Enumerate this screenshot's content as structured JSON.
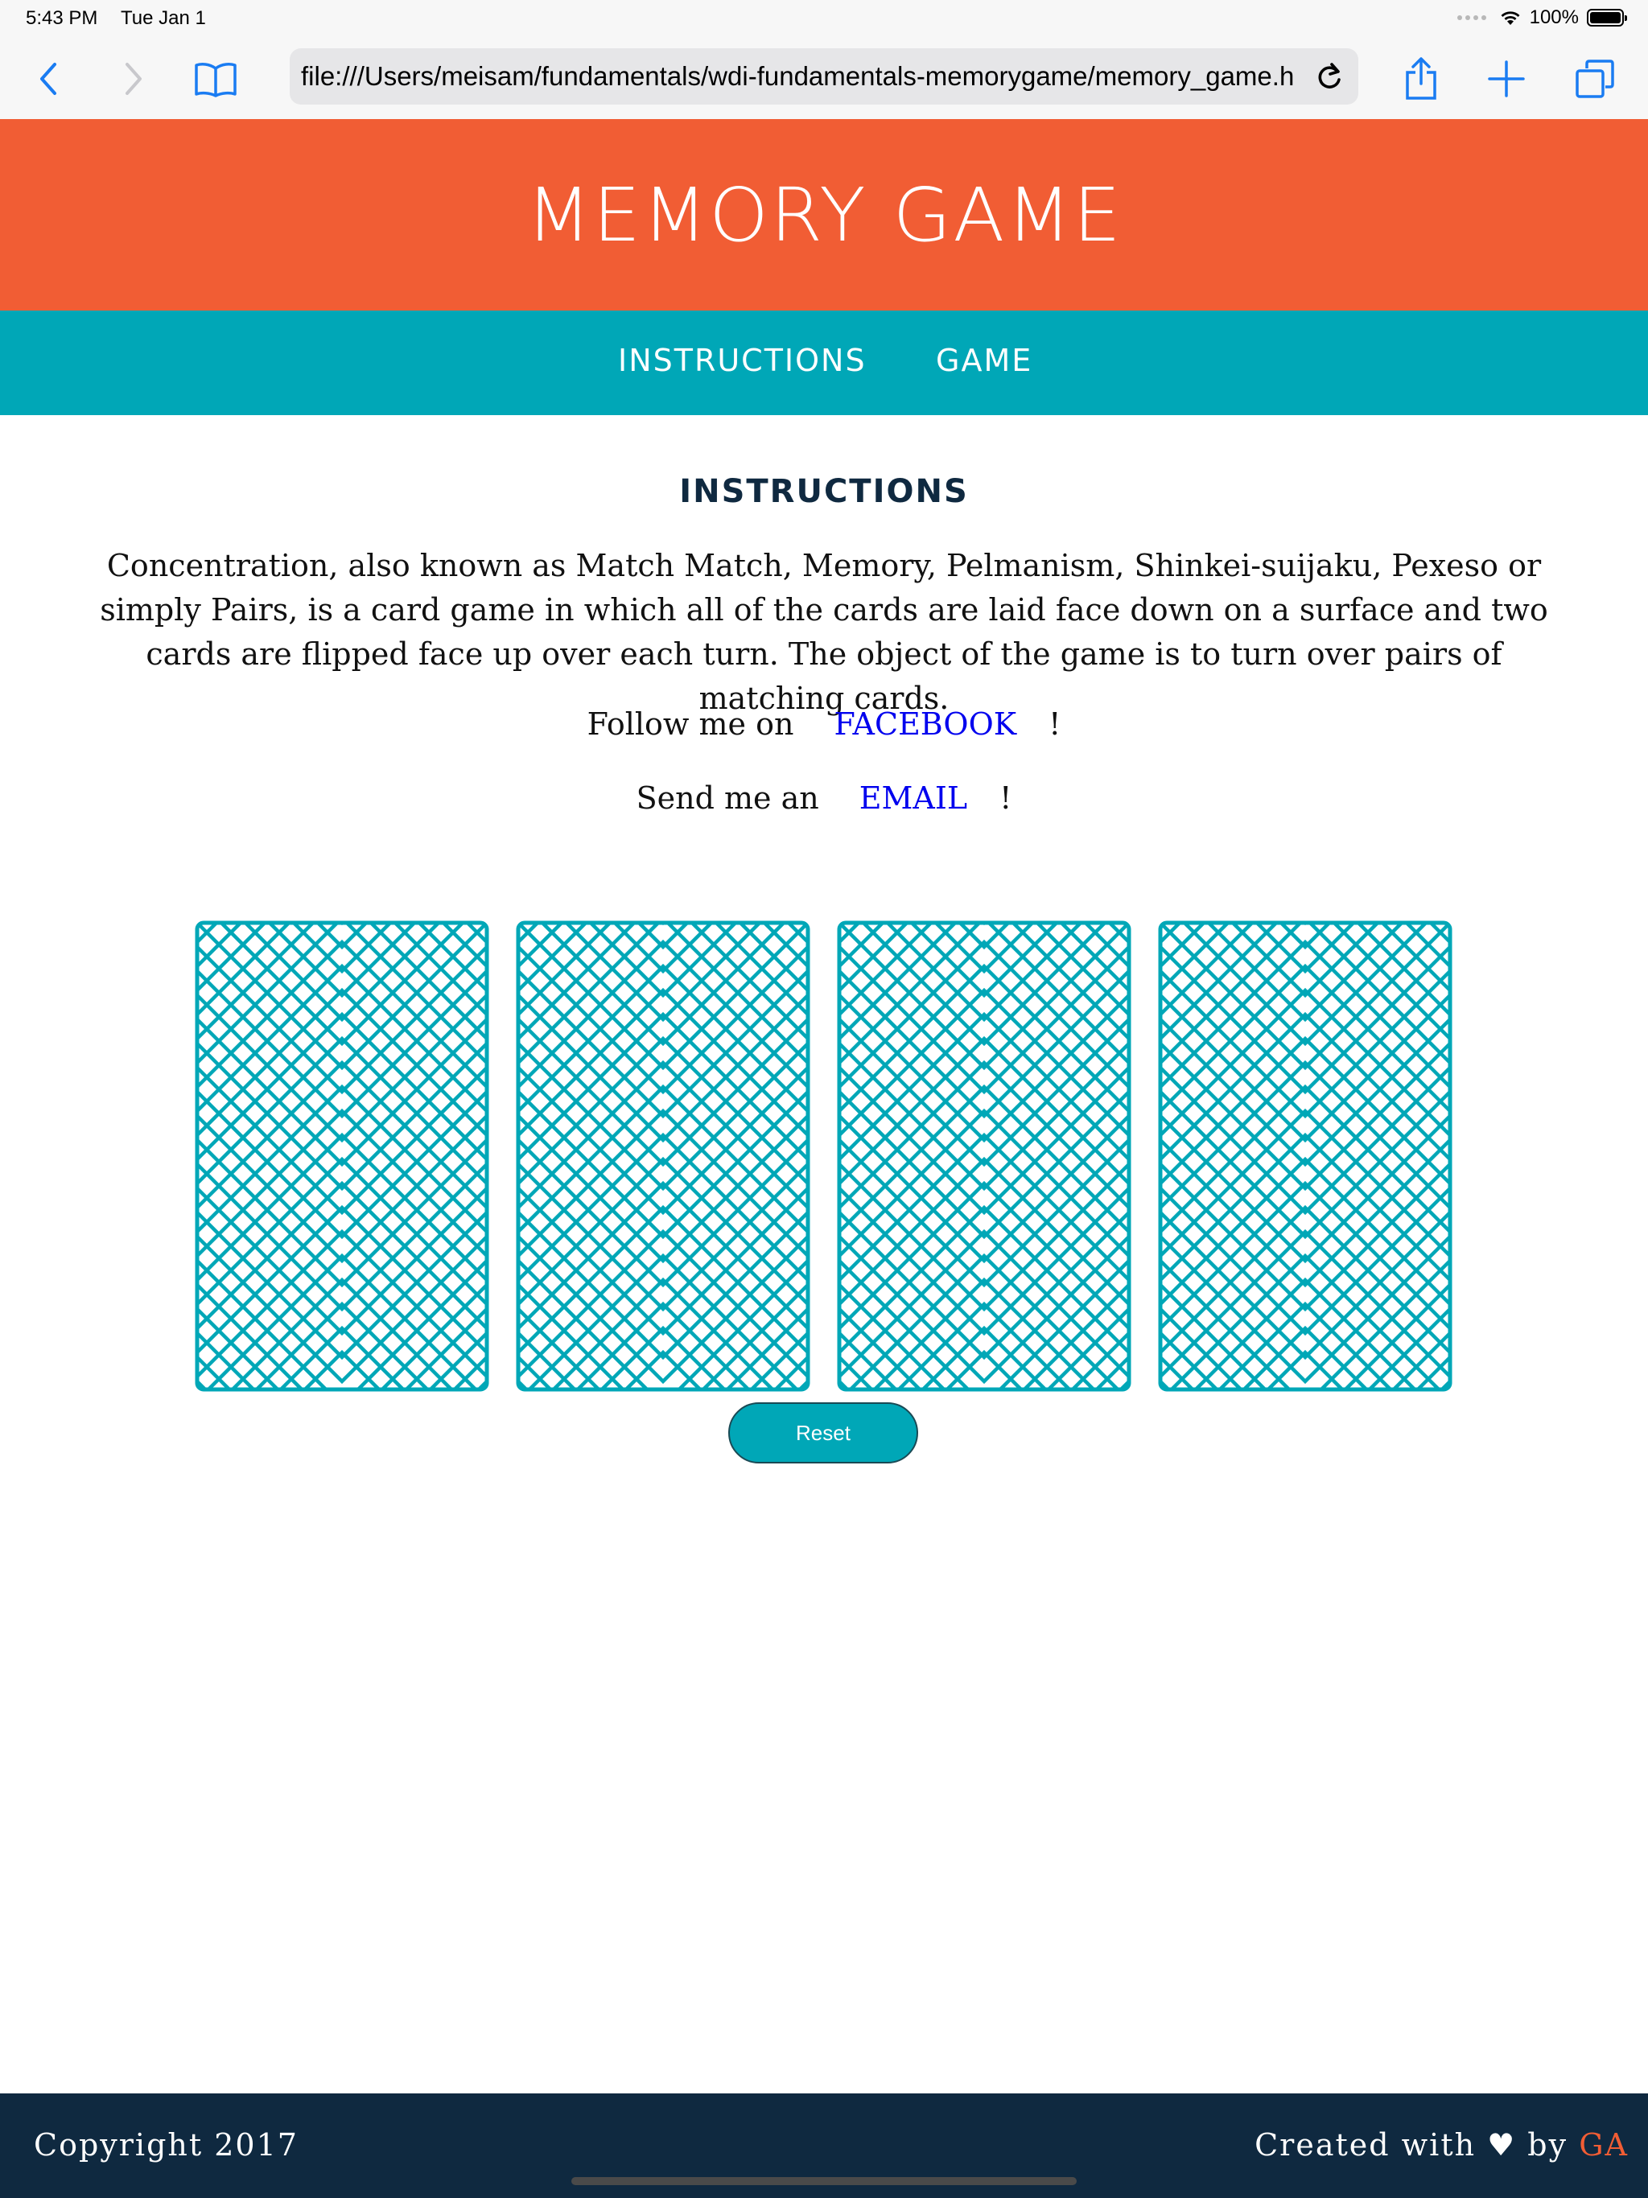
{
  "status_bar": {
    "time": "5:43 PM",
    "date": "Tue Jan 1",
    "battery": "100%",
    "battery_level": 1.0
  },
  "browser": {
    "url": "file:///Users/meisam/fundamentals/wdi-fundamentals-memorygame/memory_game.html",
    "icons": [
      "back-icon",
      "forward-icon",
      "bookmarks-icon",
      "reload-icon",
      "share-icon",
      "new-tab-icon",
      "tabs-icon"
    ]
  },
  "header": {
    "title": "MEMORY GAME"
  },
  "nav": {
    "items": [
      {
        "label": "INSTRUCTIONS"
      },
      {
        "label": "GAME"
      }
    ]
  },
  "instructions": {
    "title": "INSTRUCTIONS",
    "body": "Concentration, also known as Match Match, Memory, Pelmanism, Shinkei-suijaku, Pexeso or simply Pairs, is a card game in which all of the cards are laid face down on a surface and two cards are flipped face up over each turn. The object of the game is to turn over pairs of matching cards.",
    "follow_prefix": "Follow me on",
    "follow_link": "FACEBOOK",
    "follow_suffix": "!",
    "email_prefix": "Send me an",
    "email_link": "EMAIL",
    "email_suffix": "!"
  },
  "game": {
    "card_count": 4,
    "card_color": "#00a7b7",
    "reset_label": "Reset"
  },
  "footer": {
    "copyright": "Copyright 2017",
    "credit_prefix": "Created with ♥ by",
    "credit_link": "GA"
  },
  "colors": {
    "header_bg": "#f15d34",
    "nav_bg": "#00a7b7",
    "footer_bg": "#0f2940",
    "link": "#0000ee"
  }
}
